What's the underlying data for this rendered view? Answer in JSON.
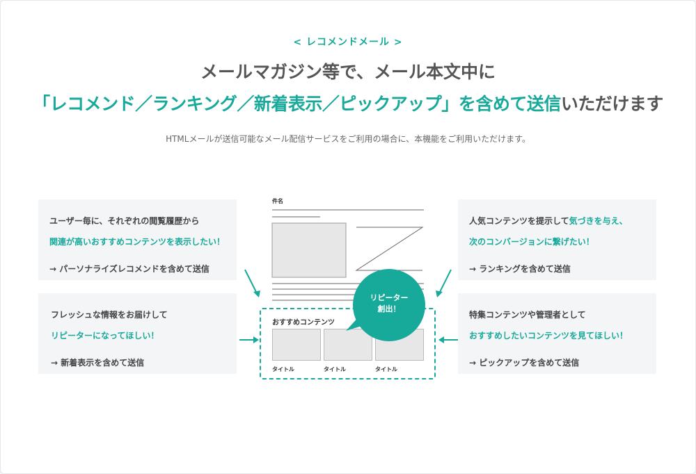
{
  "header": {
    "eyebrow": "< レコメンドメール >",
    "title_line1": "メールマガジン等で、メール本文中に",
    "title_line2_accent": "「レコメンド／ランキング／新着表示／ピックアップ」を含めて送信",
    "title_line2_plain": "いただけます",
    "subtitle": "HTMLメールが送信可能なメール配信サービスをご利用の場合に、本機能をご利用いただけます。"
  },
  "cards": {
    "top_left": {
      "line1": "ユーザー毎に、それぞれの閲覧履歴から",
      "line2": "関連が高いおすすめコンテンツを表示したい！",
      "line3": "→ パーソナライズレコメンドを含めて送信"
    },
    "bottom_left": {
      "line1": "フレッシュな情報をお届けして",
      "line2": "リピーターになってほしい！",
      "line3": "→ 新着表示を含めて送信"
    },
    "top_right": {
      "line1_plain": "人気コンテンツを提示して",
      "line1_accent": "気づきを与え、",
      "line2": "次のコンバージョンに繋げたい！",
      "line3": "→ ランキングを含めて送信"
    },
    "bottom_right": {
      "line1": "特集コンテンツや管理者として",
      "line2": "おすすめしたいコンテンツを見てほしい！",
      "line3": "→ ピックアップを含めて送信"
    }
  },
  "mock_email": {
    "subject_label": "件名",
    "recommend_title": "おすすめコンテンツ",
    "items": [
      "タイトル",
      "タイトル",
      "タイトル"
    ],
    "bubble_line1": "リピーター",
    "bubble_line2": "創出！"
  },
  "colors": {
    "accent": "#17a99a",
    "card_bg": "#f3f5f7",
    "text": "#555555"
  }
}
